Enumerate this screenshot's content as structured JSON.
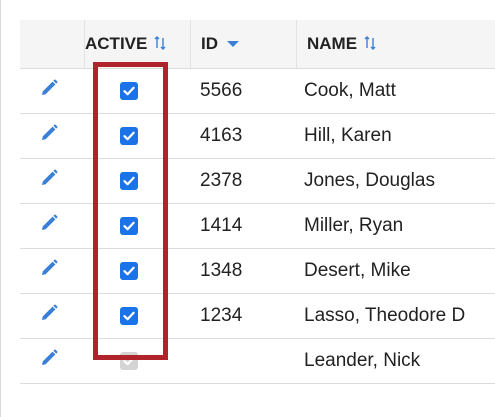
{
  "columns": {
    "active": "ACTIVE",
    "id": "ID",
    "name": "NAME"
  },
  "rows": [
    {
      "active": true,
      "disabled": false,
      "id": "5566",
      "name": "Cook, Matt"
    },
    {
      "active": true,
      "disabled": false,
      "id": "4163",
      "name": "Hill, Karen"
    },
    {
      "active": true,
      "disabled": false,
      "id": "2378",
      "name": "Jones, Douglas"
    },
    {
      "active": true,
      "disabled": false,
      "id": "1414",
      "name": "Miller, Ryan"
    },
    {
      "active": true,
      "disabled": false,
      "id": "1348",
      "name": "Desert, Mike"
    },
    {
      "active": true,
      "disabled": false,
      "id": "1234",
      "name": "Lasso, Theodore D"
    },
    {
      "active": true,
      "disabled": true,
      "id": "",
      "name": "Leander, Nick"
    }
  ],
  "icons": {
    "edit": "pencil-icon",
    "sort_active": "sort-icon",
    "sort_id": "sort-desc-icon",
    "sort_name": "sort-icon",
    "checkbox": "checkmark-icon"
  },
  "colors": {
    "accent": "#1a73e8",
    "highlight_border": "#b0232a",
    "sort_icon": "#3a7fd6",
    "header_bg": "#f5f5f5",
    "disabled_checkbox": "#d4d4d4"
  }
}
